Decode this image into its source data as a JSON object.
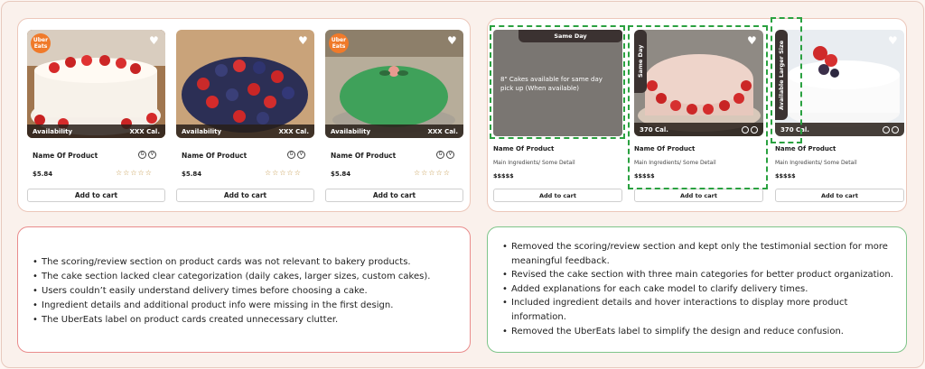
{
  "before": {
    "cards": [
      {
        "name": "Name Of Product",
        "price": "$5.84",
        "availability": "Availability",
        "calories": "XXX Cal.",
        "cart": "Add to cart",
        "uber": "Uber Eats",
        "stars": "☆☆☆☆☆"
      },
      {
        "name": "Name Of Product",
        "price": "$5.84",
        "availability": "Availability",
        "calories": "XXX Cal.",
        "cart": "Add to cart",
        "stars": "☆☆☆☆☆"
      },
      {
        "name": "Name Of Product",
        "price": "$5.84",
        "availability": "Availability",
        "calories": "XXX Cal.",
        "cart": "Add to cart",
        "uber": "Uber Eats",
        "stars": "☆☆☆☆☆"
      }
    ],
    "notes": [
      "The scoring/review section on product cards was not relevant to bakery products.",
      "The cake section lacked clear categorization (daily cakes, larger sizes, custom cakes).",
      "Users couldn’t easily understand delivery times before choosing a cake.",
      "Ingredient details and additional product info were missing in the first design.",
      "The UberEats label on product cards created unnecessary clutter."
    ]
  },
  "after": {
    "cards": [
      {
        "tab": "Same Day",
        "hover_text": "8\" Cakes available for same day pick up (When available)",
        "name": "Name Of Product",
        "detail": "Main Ingredients/ Some Detail",
        "price": "$$$$$",
        "cart": "Add to cart"
      },
      {
        "tab": "Same Day",
        "calories": "370 Cal.",
        "name": "Name Of Product",
        "detail": "Main Ingredients/ Some Detail",
        "price": "$$$$$",
        "cart": "Add to cart"
      },
      {
        "tab": "Available Larger Size",
        "calories": "370 Cal.",
        "name": "Name Of Product",
        "detail": "Main Ingredients/ Some Detail",
        "price": "$$$$$",
        "cart": "Add to cart"
      }
    ],
    "notes": [
      "Removed the scoring/review section and kept only the testimonial section for more meaningful feedback.",
      "Revised the cake section with three main categories for better product organization.",
      "Added explanations for each cake model to clarify delivery times.",
      "Included ingredient details and hover interactions to display more product information.",
      "Removed the UberEats label to simplify the design and reduce confusion."
    ]
  },
  "icons": {
    "heart": "heart-icon",
    "diet_a": "gluten-free-icon",
    "diet_b": "vegan-icon"
  }
}
